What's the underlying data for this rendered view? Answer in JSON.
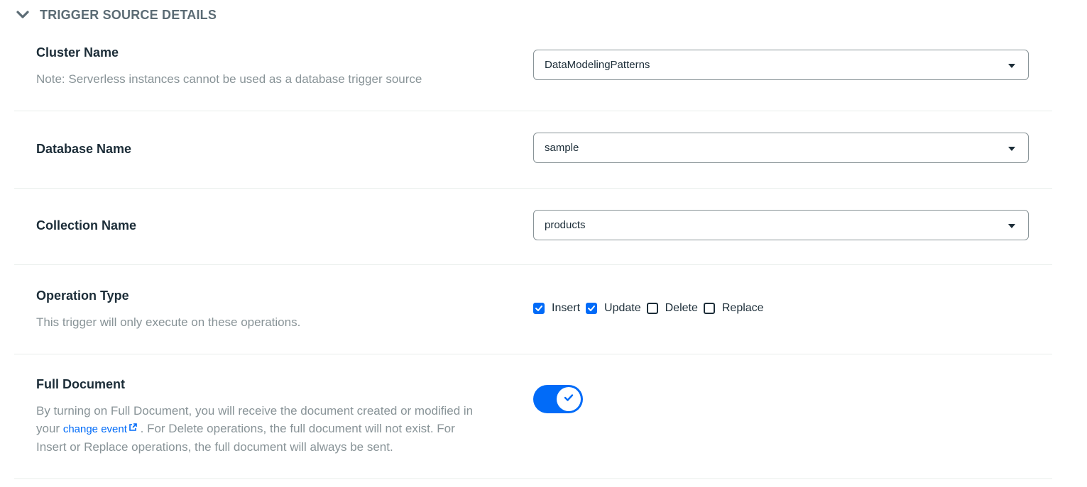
{
  "section": {
    "title": "TRIGGER SOURCE DETAILS",
    "toggle_icon": "chevron-down-icon"
  },
  "cluster": {
    "label": "Cluster Name",
    "note": "Note: Serverless instances cannot be used as a database trigger source",
    "value": "DataModelingPatterns"
  },
  "database": {
    "label": "Database Name",
    "value": "sample"
  },
  "collection": {
    "label": "Collection Name",
    "value": "products"
  },
  "operation": {
    "label": "Operation Type",
    "note": "This trigger will only execute on these operations.",
    "options": [
      {
        "label": "Insert",
        "checked": true
      },
      {
        "label": "Update",
        "checked": true
      },
      {
        "label": "Delete",
        "checked": false
      },
      {
        "label": "Replace",
        "checked": false
      }
    ]
  },
  "full_document": {
    "label": "Full Document",
    "desc_line1": "By turning on Full Document, you will receive the document created or modified in",
    "desc_pre": "your",
    "link_text": "change event",
    "desc_post": ". For Delete operations, the full document will not exist. For",
    "desc_line3": "Insert or Replace operations, the full document will always be sent.",
    "enabled": true
  },
  "colors": {
    "accent": "#016bf8",
    "text": "#1c2d38",
    "muted": "#889397",
    "header": "#5c6c75"
  }
}
